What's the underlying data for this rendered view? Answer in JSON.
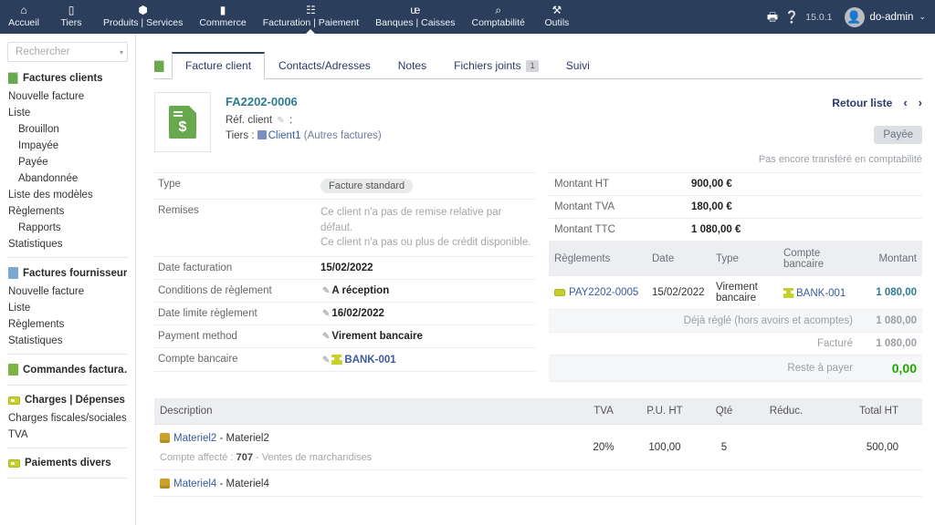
{
  "topnav": {
    "items": [
      {
        "label": "Accueil",
        "icon": "home-icon",
        "glyph": "⌂",
        "active": false
      },
      {
        "label": "Tiers",
        "icon": "users-icon",
        "glyph": "▯",
        "active": false
      },
      {
        "label": "Produits | Services",
        "icon": "box-icon",
        "glyph": "⬢",
        "active": false
      },
      {
        "label": "Commerce",
        "icon": "briefcase-icon",
        "glyph": "▮",
        "active": false
      },
      {
        "label": "Facturation | Paiement",
        "icon": "invoice-icon",
        "glyph": "☷",
        "active": true
      },
      {
        "label": "Banques | Caisses",
        "icon": "bank-icon",
        "glyph": "ᵫ",
        "active": false
      },
      {
        "label": "Comptabilité",
        "icon": "search-accounting-icon",
        "glyph": "⌕",
        "active": false
      },
      {
        "label": "Outils",
        "icon": "wrench-icon",
        "glyph": "⚒",
        "active": false
      }
    ],
    "print_icon": "printer-icon",
    "help_icon": "help-icon",
    "version": "15.0.1",
    "user": "do-admin",
    "user_caret": "⌄"
  },
  "sidebar": {
    "search": {
      "placeholder": "Rechercher",
      "value": "",
      "caret": "▾"
    },
    "groups": [
      {
        "title": "Factures clients",
        "icon": "invoice-green-icon",
        "items": [
          {
            "label": "Nouvelle facture",
            "sub": false
          },
          {
            "label": "Liste",
            "sub": false
          },
          {
            "label": "Brouillon",
            "sub": true
          },
          {
            "label": "Impayée",
            "sub": true
          },
          {
            "label": "Payée",
            "sub": true
          },
          {
            "label": "Abandonnée",
            "sub": true
          },
          {
            "label": "Liste des modèles",
            "sub": false
          },
          {
            "label": "Règlements",
            "sub": false
          },
          {
            "label": "Rapports",
            "sub": true
          },
          {
            "label": "Statistiques",
            "sub": false
          }
        ]
      },
      {
        "title": "Factures fournisseur",
        "icon": "invoice-blue-icon",
        "items": [
          {
            "label": "Nouvelle facture",
            "sub": false
          },
          {
            "label": "Liste",
            "sub": false
          },
          {
            "label": "Règlements",
            "sub": false
          },
          {
            "label": "Statistiques",
            "sub": false
          }
        ]
      },
      {
        "title": "Commandes factura…",
        "icon": "order-green-icon",
        "items": []
      },
      {
        "title": "Charges | Dépenses …",
        "icon": "bill-icon",
        "items": [
          {
            "label": "Charges fiscales/sociales",
            "sub": false
          },
          {
            "label": "TVA",
            "sub": false
          }
        ]
      },
      {
        "title": "Paiements divers",
        "icon": "bill-icon",
        "items": []
      }
    ]
  },
  "tabs": {
    "lead_icon": "invoice-green-icon",
    "items": [
      {
        "label": "Facture client",
        "active": true,
        "badge": ""
      },
      {
        "label": "Contacts/Adresses",
        "active": false,
        "badge": ""
      },
      {
        "label": "Notes",
        "active": false,
        "badge": ""
      },
      {
        "label": "Fichiers joints",
        "active": false,
        "badge": "1"
      },
      {
        "label": "Suivi",
        "active": false,
        "badge": ""
      }
    ]
  },
  "invoice": {
    "icon": "invoice-document-icon",
    "ref": "FA2202-0006",
    "client_ref_label": "Réf. client",
    "client_ref_sep": ":",
    "client_ref_value": "",
    "tiers_label": "Tiers :",
    "tiers_name": "Client1",
    "tiers_other": "(Autres factures)",
    "back_label": "Retour liste",
    "prev_arrow": "‹",
    "next_arrow": "›",
    "status": "Payée",
    "transfer_note": "Pas encore transféré en comptabilité"
  },
  "details": [
    {
      "key": "Type",
      "value": "Facture standard",
      "kind": "chip",
      "pencil": false
    },
    {
      "key": "Remises",
      "value": "Ce client n'a pas de remise relative par défaut.\nCe client n'a pas ou plus de crédit disponible.",
      "kind": "muted",
      "pencil": false
    },
    {
      "key": "Date facturation",
      "value": "15/02/2022",
      "kind": "text",
      "pencil": false
    },
    {
      "key": "Conditions de règlement",
      "value": "A réception",
      "kind": "text",
      "pencil": true
    },
    {
      "key": "Date limite règlement",
      "value": "16/02/2022",
      "kind": "text",
      "pencil": true
    },
    {
      "key": "Payment method",
      "value": "Virement bancaire",
      "kind": "text",
      "pencil": true
    },
    {
      "key": "Compte bancaire",
      "value": "BANK-001",
      "kind": "bank",
      "pencil": true
    }
  ],
  "amounts": [
    {
      "key": "Montant HT",
      "value": "900,00 €"
    },
    {
      "key": "Montant TVA",
      "value": "180,00 €"
    },
    {
      "key": "Montant TTC",
      "value": "1 080,00 €"
    }
  ],
  "payments": {
    "headers": [
      "Règlements",
      "Date",
      "Type",
      "Compte bancaire",
      "Montant"
    ],
    "rows": [
      {
        "ref": "PAY2202-0005",
        "date": "15/02/2022",
        "type": "Virement bancaire",
        "account": "BANK-001",
        "amount": "1 080,00"
      }
    ],
    "summary": [
      {
        "label": "Déjà réglé (hors avoirs et acomptes)",
        "value": "1 080,00",
        "highlight": false
      },
      {
        "label": "Facturé",
        "value": "1 080,00",
        "highlight": false
      },
      {
        "label": "Reste à payer",
        "value": "0,00",
        "highlight": true
      }
    ]
  },
  "lines": {
    "headers": {
      "description": "Description",
      "tva": "TVA",
      "pu": "P.U. HT",
      "qty": "Qté",
      "reduc": "Réduc.",
      "total": "Total HT"
    },
    "rows": [
      {
        "product": "Materiel2",
        "label": "Materiel2",
        "account_note_label": "Compte affecté :",
        "account_code": "707",
        "account_name": "- Ventes de marchandises",
        "tva": "20%",
        "pu": "100,00",
        "qty": "5",
        "reduc": "",
        "total": "500,00"
      },
      {
        "product": "Materiel4",
        "label": "Materiel4",
        "account_note_label": "",
        "account_code": "",
        "account_name": "",
        "tva": "",
        "pu": "",
        "qty": "",
        "reduc": "",
        "total": ""
      }
    ]
  },
  "colors": {
    "header_bg": "#2b3f5c",
    "accent_link": "#3a5ba0",
    "ref_teal": "#2e7d8f",
    "green_ok": "#1faa00",
    "icon_green": "#6aa84f",
    "icon_lime": "#c6d02a"
  }
}
